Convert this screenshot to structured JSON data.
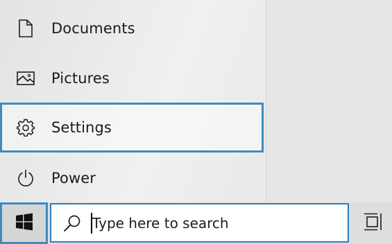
{
  "start_menu": {
    "items": [
      {
        "label": "Documents",
        "icon": "document-icon"
      },
      {
        "label": "Pictures",
        "icon": "pictures-icon"
      },
      {
        "label": "Settings",
        "icon": "gear-icon",
        "highlighted": true
      },
      {
        "label": "Power",
        "icon": "power-icon"
      }
    ]
  },
  "taskbar": {
    "start_icon": "windows-logo-icon",
    "search": {
      "placeholder": "Type here to search",
      "value": "",
      "icon": "search-icon"
    },
    "task_view_icon": "task-view-icon"
  },
  "colors": {
    "focus_border": "#3c8cc0",
    "search_border": "#2b7fc3"
  }
}
